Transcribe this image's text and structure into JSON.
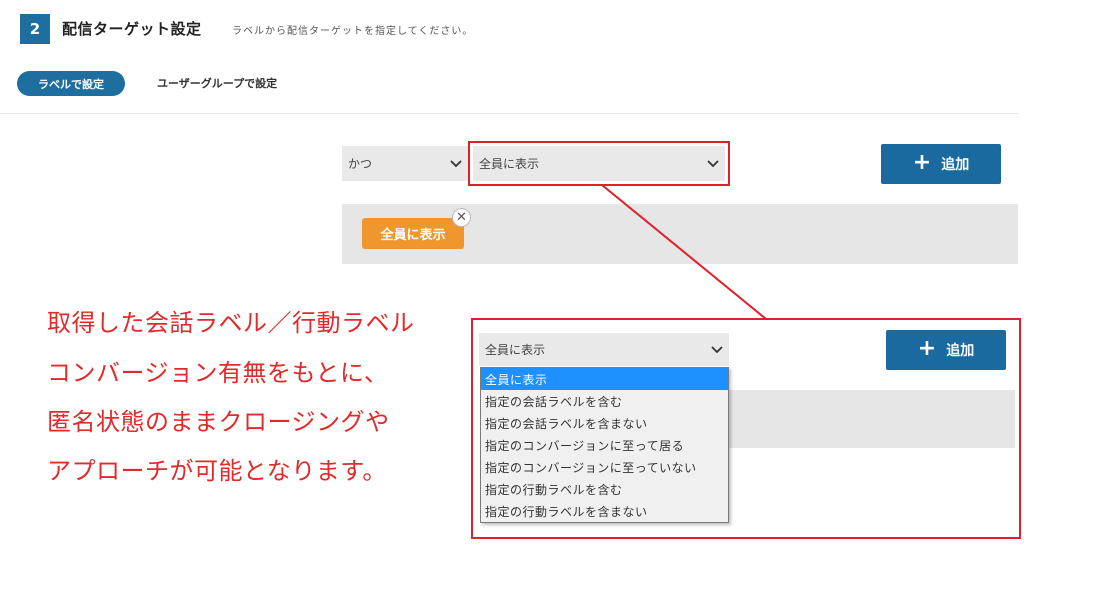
{
  "header": {
    "step_number": "2",
    "title": "配信ターゲット設定",
    "description": "ラベルから配信ターゲットを指定してください。"
  },
  "tabs": [
    {
      "label": "ラベルで設定",
      "active": true
    },
    {
      "label": "ユーザーグループで設定",
      "active": false
    }
  ],
  "row1": {
    "operator_value": "かつ",
    "condition_value": "全員に表示",
    "add_label": "追加",
    "chip_label": "全員に表示"
  },
  "row2": {
    "condition_value": "全員に表示",
    "add_label": "追加"
  },
  "dropdown_options": [
    "全員に表示",
    "指定の会話ラベルを含む",
    "指定の会話ラベルを含まない",
    "指定のコンバージョンに至って居る",
    "指定のコンバージョンに至っていない",
    "指定の行動ラベルを含む",
    "指定の行動ラベルを含まない"
  ],
  "annotation_lines": [
    "取得した会話ラベル／行動ラベル",
    "コンバージョン有無をもとに、",
    "匿名状態のままクロージングや",
    "アプローチが可能となります。"
  ],
  "colors": {
    "primary": "#1e6fa0",
    "chip": "#f0962f",
    "highlight_red": "#e0202a",
    "annotation_red": "#e12a2a",
    "selected_option": "#1e90ff"
  }
}
